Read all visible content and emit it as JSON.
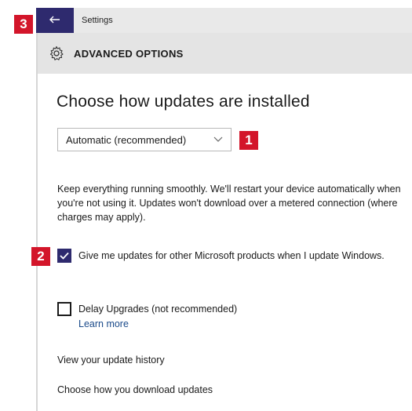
{
  "window": {
    "title": "Settings",
    "back_icon": "back-arrow-icon"
  },
  "header": {
    "icon": "gear-icon",
    "title": "ADVANCED OPTIONS"
  },
  "main": {
    "section_title": "Choose how updates are installed",
    "install_mode_select": {
      "selected": "Automatic (recommended)"
    },
    "description": "Keep everything running smoothly. We'll restart your device automatically when you're not using it. Updates won't download over a metered connection (where charges may apply).",
    "checkboxes": [
      {
        "label": "Give me updates for other Microsoft products when I update Windows.",
        "checked": true
      },
      {
        "label": "Delay Upgrades (not recommended)",
        "checked": false,
        "link": "Learn more"
      }
    ],
    "links": {
      "history": "View your update history",
      "download": "Choose how you download updates"
    }
  },
  "callouts": {
    "dropdown": "1",
    "checkbox": "2",
    "back": "3",
    "color": "#d3152a"
  },
  "colors": {
    "accent": "#2e2a6e"
  }
}
